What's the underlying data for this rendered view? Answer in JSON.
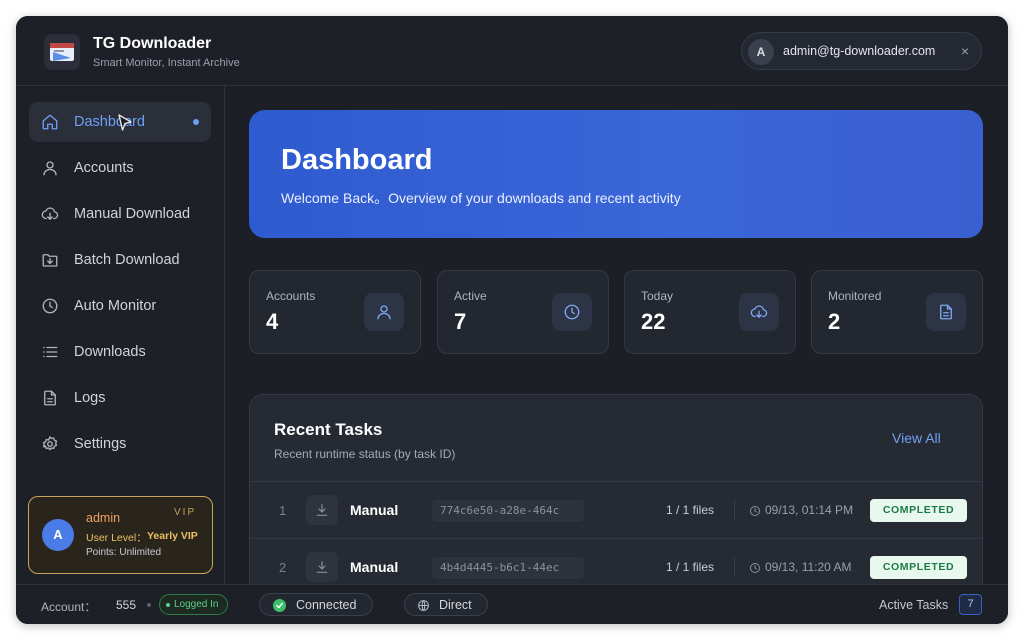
{
  "app": {
    "title": "TG Downloader",
    "subtitle": "Smart Monitor, Instant Archive",
    "user_email": "admin@tg-downloader.com",
    "user_initial": "A",
    "close_symbol": "×"
  },
  "sidebar": {
    "items": [
      {
        "label": "Dashboard",
        "icon": "home-icon",
        "active": true
      },
      {
        "label": "Accounts",
        "icon": "user-icon"
      },
      {
        "label": "Manual Download",
        "icon": "cloud-download-icon"
      },
      {
        "label": "Batch Download",
        "icon": "folder-download-icon"
      },
      {
        "label": "Auto Monitor",
        "icon": "clock-icon"
      },
      {
        "label": "Downloads",
        "icon": "list-icon"
      },
      {
        "label": "Logs",
        "icon": "file-text-icon"
      },
      {
        "label": "Settings",
        "icon": "gear-icon"
      }
    ],
    "user_card": {
      "initial": "A",
      "name": "admin",
      "badge": "VIP",
      "level_label": "User Level：",
      "level_value": "Yearly VIP",
      "points": "Points: Unlimited"
    }
  },
  "hero": {
    "title": "Dashboard",
    "subtitle": "Welcome Back。Overview of your downloads and recent activity"
  },
  "stats": [
    {
      "label": "Accounts",
      "value": "4",
      "icon": "user-icon"
    },
    {
      "label": "Active",
      "value": "7",
      "icon": "clock-icon"
    },
    {
      "label": "Today",
      "value": "22",
      "icon": "cloud-download-icon"
    },
    {
      "label": "Monitored",
      "value": "2",
      "icon": "file-text-icon"
    }
  ],
  "tasks": {
    "title": "Recent Tasks",
    "subtitle": "Recent runtime status (by task ID)",
    "view_all": "View All",
    "rows": [
      {
        "num": "1",
        "type": "Manual",
        "id": "774c6e50-a28e-464c",
        "files": "1 / 1 files",
        "time": "09/13, 01:14 PM",
        "status": "COMPLETED"
      },
      {
        "num": "2",
        "type": "Manual",
        "id": "4b4d4445-b6c1-44ec",
        "files": "1 / 1 files",
        "time": "09/13, 11:20 AM",
        "status": "COMPLETED"
      }
    ]
  },
  "footer": {
    "account_label": "Account：",
    "account_value": "555",
    "login_status": "Logged In",
    "connection": "Connected",
    "mode": "Direct",
    "active_tasks_label": "Active Tasks",
    "active_tasks_count": "7"
  },
  "colors": {
    "accent": "#6ea0f5",
    "hero_blue": "#3a66d8",
    "vip_gold": "#c8a35a",
    "success": "#3fbf6a"
  }
}
